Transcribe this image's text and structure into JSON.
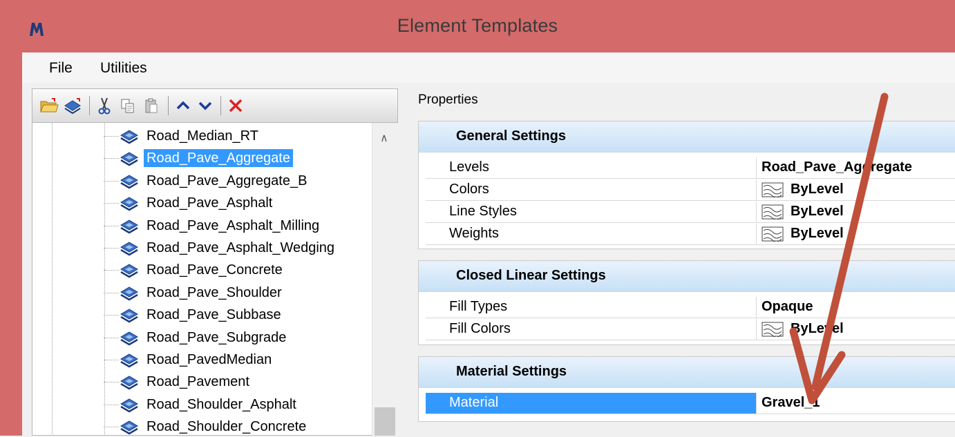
{
  "window": {
    "title": "Element Templates"
  },
  "menu": {
    "file": "File",
    "utilities": "Utilities"
  },
  "tree": {
    "selected_index": 1,
    "items": [
      "Road_Median_RT",
      "Road_Pave_Aggregate",
      "Road_Pave_Aggregate_B",
      "Road_Pave_Asphalt",
      "Road_Pave_Asphalt_Milling",
      "Road_Pave_Asphalt_Wedging",
      "Road_Pave_Concrete",
      "Road_Pave_Shoulder",
      "Road_Pave_Subbase",
      "Road_Pave_Subgrade",
      "Road_PavedMedian",
      "Road_Pavement",
      "Road_Shoulder_Asphalt",
      "Road_Shoulder_Concrete"
    ]
  },
  "properties": {
    "label": "Properties",
    "general": {
      "title": "General Settings",
      "rows": [
        {
          "name": "Levels",
          "value": "Road_Pave_Aggregate"
        },
        {
          "name": "Colors",
          "value": "ByLevel"
        },
        {
          "name": "Line Styles",
          "value": "ByLevel"
        },
        {
          "name": "Weights",
          "value": "ByLevel"
        }
      ]
    },
    "closed_linear": {
      "title": "Closed Linear Settings",
      "rows": [
        {
          "name": "Fill Types",
          "value": "Opaque"
        },
        {
          "name": "Fill Colors",
          "value": "ByLevel"
        }
      ]
    },
    "material": {
      "title": "Material Settings",
      "rows": [
        {
          "name": "Material",
          "value": "Gravel_1"
        }
      ]
    }
  },
  "colors": {
    "titlebar": "#d46a6a",
    "selection": "#3399ff",
    "annotation_arrow": "#c0503a"
  }
}
